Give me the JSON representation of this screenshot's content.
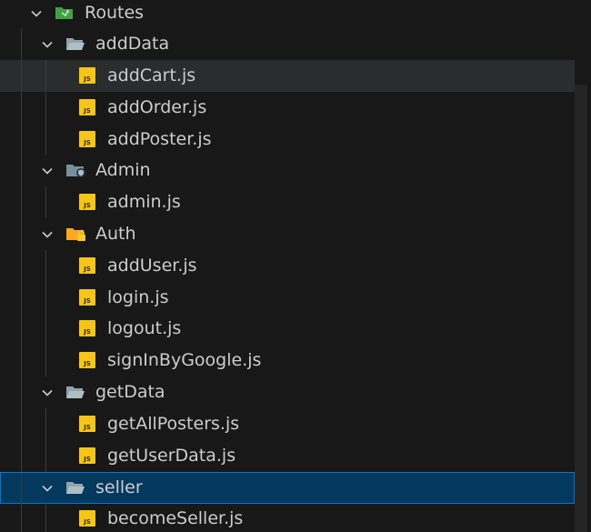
{
  "explorer": {
    "root": {
      "label": "Routes",
      "icon": "routes-folder-icon",
      "expanded": true
    },
    "folders": [
      {
        "label": "addData",
        "icon": "folder-open-icon",
        "expanded": true,
        "files": [
          "addCart.js",
          "addOrder.js",
          "addPoster.js"
        ]
      },
      {
        "label": "Admin",
        "icon": "admin-folder-icon",
        "expanded": true,
        "files": [
          "admin.js"
        ]
      },
      {
        "label": "Auth",
        "icon": "auth-folder-icon",
        "expanded": true,
        "files": [
          "addUser.js",
          "login.js",
          "logout.js",
          "signInByGoogle.js"
        ]
      },
      {
        "label": "getData",
        "icon": "folder-open-icon",
        "expanded": true,
        "files": [
          "getAllPosters.js",
          "getUserData.js"
        ]
      },
      {
        "label": "seller",
        "icon": "folder-open-icon",
        "expanded": true,
        "files": [
          "becomeSeller.js"
        ]
      }
    ],
    "file_icon_text": "JS",
    "hovered_item": "addCart.js",
    "selected_item": "seller",
    "colors": {
      "background": "#181818",
      "hover": "#2a2d2e",
      "selected": "#04395e",
      "selected_border": "#0078d4",
      "js_badge": "#f5c518",
      "folder": "#90a4ae",
      "routes_folder": "#43a047"
    }
  }
}
